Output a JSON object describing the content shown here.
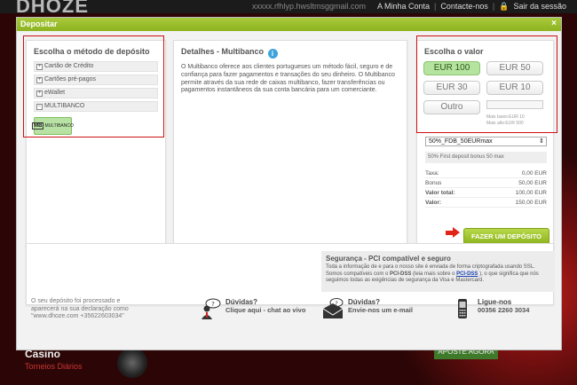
{
  "background": {
    "logo": "DHOZE",
    "user_email": "xxxxx.rfhlyp.hwsltmsggmail.com",
    "nav": [
      "A Minha Conta",
      "Contacte-nos",
      "Sair da sessão"
    ],
    "casino_title": "Casino",
    "casino_subtitle": "Torneios Diários",
    "promo_button": "APOSTE AGORA"
  },
  "modal": {
    "title": "Depositar",
    "close": "×"
  },
  "method_panel": {
    "title": "Escolha o método de depósito",
    "items": [
      {
        "toggle": "+",
        "label": "Cartão de Crédito"
      },
      {
        "toggle": "+",
        "label": "Cartões pré-pagos"
      },
      {
        "toggle": "+",
        "label": "eWallet"
      },
      {
        "toggle": "−",
        "label": "MULTIBANCO"
      }
    ],
    "selected_logo": {
      "mark": "MB",
      "label": "MULTIBANCO"
    }
  },
  "details_panel": {
    "title": "Detalhes - Multibanco",
    "info": "i",
    "text": "O Multibanco oferece aos clientes portugueses um método fácil, seguro e de confiança para fazer pagamentos e transações do seu dinheiro. O Multibanco permite através da sua rede de caixas multibanco, fazer transferências ou pagamentos instantâneos da sua conta bancária para um comerciante."
  },
  "value_panel": {
    "title": "Escolha o valor",
    "amounts": [
      "EUR 100",
      "EUR 50",
      "EUR 30",
      "EUR 10"
    ],
    "selected_amount": "EUR 100",
    "other_label": "Outro",
    "min": "Mais baixo:EUR 10",
    "max": "Mais alto:EUR 500",
    "bonus_code": "50%_FDB_50EURmax",
    "bonus_description": "50% First deposit bonus 50 max",
    "summary": [
      {
        "key": "Taxa:",
        "value": "0,00 EUR",
        "bold": false
      },
      {
        "key": "Bonus",
        "value": "50,00 EUR",
        "bold": false
      },
      {
        "key": "Valor total:",
        "value": "100,00 EUR",
        "bold": true
      },
      {
        "key": "Valor:",
        "value": "150,00 EUR",
        "bold": true
      }
    ],
    "deposit_button": "FAZER UM DEPÓSITO"
  },
  "security": {
    "title": "Segurança - PCI compatível e seguro",
    "text_1": "Toda a informação de e para o nosso site é enviada de forma criptografada usando SSL.",
    "text_2": "Somos compatíveis com o ",
    "pci": "PCI-DSS",
    "text_3": " (leia mais sobre o ",
    "pci_link": "PCI-DSS",
    "text_4": "), o que significa que nós seguimos todas as exigências de segurança da Visa e Mastercard."
  },
  "footer": {
    "note": "O seu depósito foi processado e aparecerá na sua declaração como \"www.dhoze.com +35622603034\"",
    "chat_title": "Dúvidas?",
    "chat_sub": "Clique aqui - chat ao vivo",
    "email_title": "Dúvidas?",
    "email_sub": "Envie-nos um e-mail",
    "phone_title": "Ligue-nos",
    "phone_number": "00356 2260 3034"
  },
  "colors": {
    "accent": "#8db31f",
    "selected": "#b5e3a0",
    "alert_red": "#e2231a",
    "info_blue": "#3fa3dc"
  }
}
